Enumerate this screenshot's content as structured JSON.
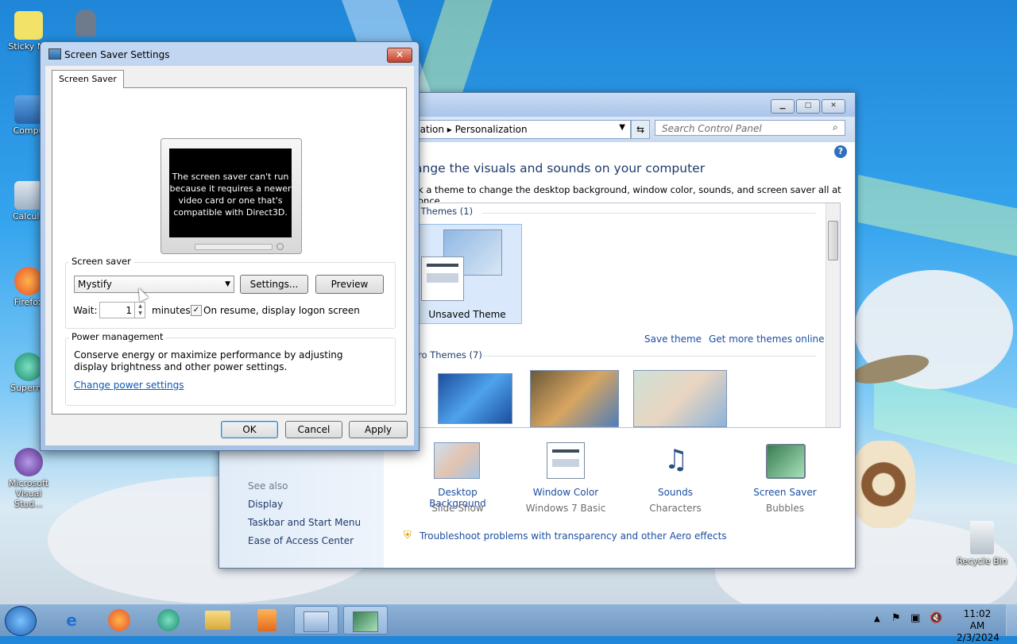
{
  "desktop": {
    "icons": [
      {
        "label": "Sticky No"
      },
      {
        "label": "Compu"
      },
      {
        "label": "Calcula"
      },
      {
        "label": "Firefox"
      },
      {
        "label": "Supermi"
      },
      {
        "label": "Microsoft Visual Stud..."
      },
      {
        "label": "Recycle Bin"
      }
    ]
  },
  "control_panel": {
    "breadcrumb": "ization  ▸  Personalization",
    "search_placeholder": "Search Control Panel",
    "heading": "ange the visuals and sounds on your computer",
    "subheading": "k a theme to change the desktop background, window color, sounds, and screen saver all at once.",
    "my_themes_label": "y Themes (1)",
    "unsaved_theme": "Unsaved Theme",
    "save_theme": "Save theme",
    "get_more_themes": "Get more themes online",
    "aero_themes_label": "ero Themes (7)",
    "see_also": "See also",
    "see_also_links": [
      "Display",
      "Taskbar and Start Menu",
      "Ease of Access Center"
    ],
    "bottom_items": [
      {
        "label": "Desktop Background",
        "sub": "Slide Show"
      },
      {
        "label": "Window Color",
        "sub": "Windows 7 Basic"
      },
      {
        "label": "Sounds",
        "sub": "Characters"
      },
      {
        "label": "Screen Saver",
        "sub": "Bubbles"
      }
    ],
    "troubleshoot": "Troubleshoot problems with transparency and other Aero effects"
  },
  "dialog": {
    "title": "Screen Saver Settings",
    "tab": "Screen Saver",
    "preview_message": "The screen saver can't run because it requires a newer video card or one that's compatible with Direct3D.",
    "screensaver_group": "Screen saver",
    "screensaver_selected": "Mystify",
    "settings_button": "Settings...",
    "preview_button": "Preview",
    "wait_label": "Wait:",
    "wait_value": "1",
    "minutes_label": "minutes",
    "resume_checkbox": "On resume, display logon screen",
    "resume_checked": true,
    "power_group": "Power management",
    "power_text": "Conserve energy or maximize performance by adjusting display brightness and other power settings.",
    "power_link": "Change power settings",
    "ok": "OK",
    "cancel": "Cancel",
    "apply": "Apply"
  },
  "taskbar": {
    "time": "11:02 AM",
    "date": "2/3/2024"
  }
}
